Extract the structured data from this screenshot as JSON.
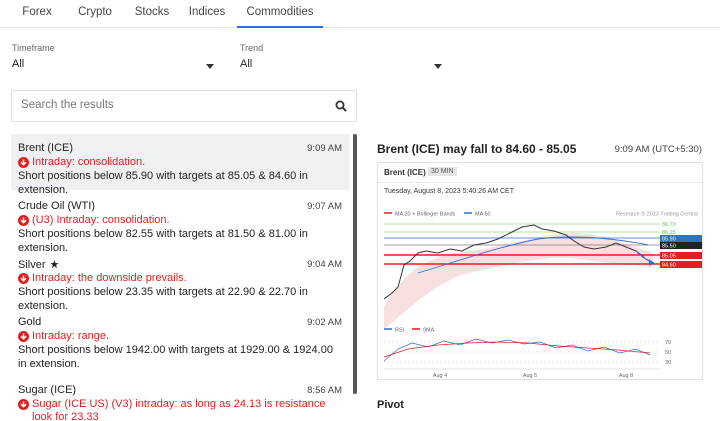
{
  "tabs": [
    {
      "label": "Forex",
      "active": false
    },
    {
      "label": "Crypto",
      "active": false
    },
    {
      "label": "Stocks",
      "active": false
    },
    {
      "label": "Indices",
      "active": false
    },
    {
      "label": "Commodities",
      "active": true
    }
  ],
  "filters": {
    "timeframe_label": "Timeframe",
    "timeframe_value": "All",
    "trend_label": "Trend",
    "trend_value": "All"
  },
  "search": {
    "placeholder": "Search the results"
  },
  "results": [
    {
      "name": "Brent (ICE)",
      "time": "9:09 AM",
      "verdict": "Intraday: consolidation.",
      "desc": "Short positions below 85.90 with targets at 85.05 & 84.60 in extension.",
      "selected": true
    },
    {
      "name": "Crude Oil (WTI)",
      "time": "9:07 AM",
      "verdict": "(U3) Intraday: consolidation.",
      "desc": "Short positions below 82.55 with targets at 81.50 & 81.00 in extension."
    },
    {
      "name": "Silver",
      "time": "9:04 AM",
      "verdict": "Intraday: the downside prevails.",
      "desc": "Short positions below 23.35 with targets at 22.90 & 22.70 in extension.",
      "starred": true
    },
    {
      "name": "Gold",
      "time": "9:02 AM",
      "verdict": "Intraday: range.",
      "desc": "Short positions below 1942.00 with targets at 1929.00 & 1924.00 in extension."
    },
    {
      "name": "Sugar (ICE)",
      "time": "8:56 AM",
      "verdict": "Sugar (ICE US) (V3) intraday: as long as 24.13 is resistance look for 23.33",
      "desc": ""
    }
  ],
  "detail": {
    "title": "Brent (ICE) may fall to 84.60 - 85.05",
    "time": "9:09 AM (UTC+5:30)",
    "chart_symbol": "Brent (ICE)",
    "chart_timeframe": "30 MIN",
    "chart_date": "Tuesday, August 8, 2023 5:40:26 AM CET",
    "legend_ma20": "MA 20 + Bollinger Bands",
    "legend_ma50": "MA 50",
    "copyright": "Research © 2023 Trading Central",
    "levels": [
      "86.70",
      "86.25",
      "85.90",
      "85.50",
      "85.05",
      "84.60"
    ],
    "rsi_label": "RSI",
    "rsi_ma_label": "9MA",
    "rsi_levels": [
      "70",
      "50",
      "30"
    ],
    "x_labels": [
      "Aug 4",
      "Aug 5",
      "Aug 8"
    ],
    "section": "Pivot"
  },
  "colors": {
    "accent": "#2f6fd6",
    "bearish": "#e02020",
    "selected_bg": "#eef0f3",
    "level_green": "#6bbf59",
    "level_red": "#e02020",
    "level_blue": "#2f6fd6",
    "level_black": "#222222"
  }
}
